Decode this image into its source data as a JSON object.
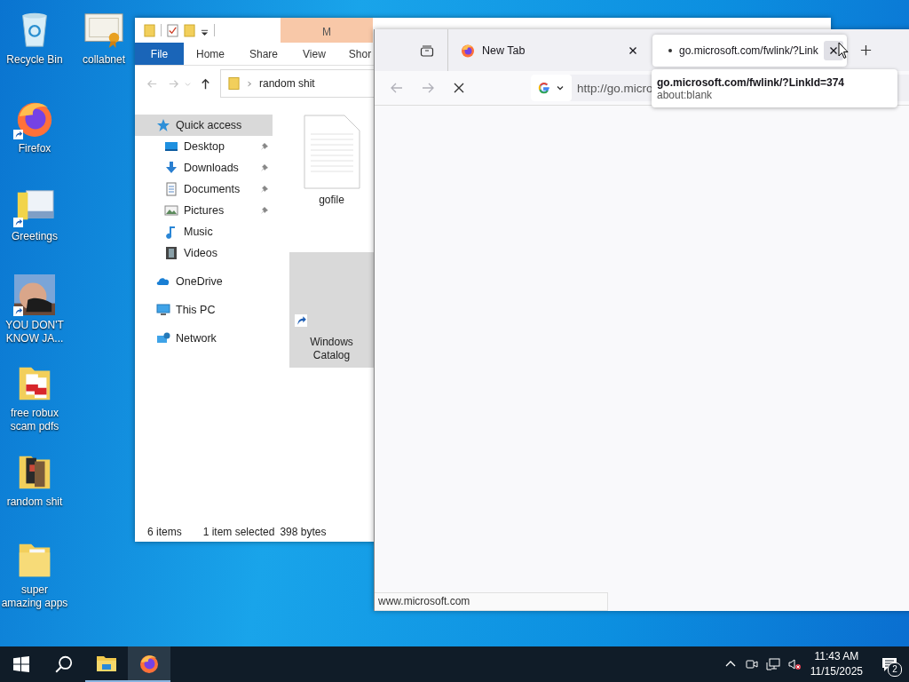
{
  "desktop_icons": [
    {
      "label": "Recycle Bin",
      "kind": "recycle-bin",
      "shortcut": false
    },
    {
      "label": "collabnet",
      "kind": "certificate",
      "shortcut": false
    },
    {
      "label": "Firefox",
      "kind": "firefox",
      "shortcut": true
    },
    {
      "label": "Greetings",
      "kind": "app",
      "shortcut": true
    },
    {
      "label": "YOU DON'T KNOW JA...",
      "kind": "picture",
      "shortcut": true
    },
    {
      "label": "free robux scam pdfs",
      "kind": "pdf-folder",
      "shortcut": false
    },
    {
      "label": "random shit",
      "kind": "film-folder",
      "shortcut": false
    },
    {
      "label": "super amazing apps",
      "kind": "folder",
      "shortcut": false
    }
  ],
  "explorer": {
    "contextual_tab": "M",
    "ribbon_tabs": [
      {
        "label": "File",
        "kind": "file"
      },
      {
        "label": "Home",
        "kind": "tab"
      },
      {
        "label": "Share",
        "kind": "tab"
      },
      {
        "label": "View",
        "kind": "tab"
      },
      {
        "label": "Shor",
        "kind": "tab"
      }
    ],
    "address": "random shit",
    "nav": [
      {
        "label": "Quick access",
        "kind": "star",
        "selected": true,
        "children": [
          {
            "label": "Desktop",
            "kind": "desktop",
            "pinned": true
          },
          {
            "label": "Downloads",
            "kind": "download",
            "pinned": true
          },
          {
            "label": "Documents",
            "kind": "document",
            "pinned": true
          },
          {
            "label": "Pictures",
            "kind": "pictures",
            "pinned": true
          },
          {
            "label": "Music",
            "kind": "music",
            "pinned": false
          },
          {
            "label": "Videos",
            "kind": "videos",
            "pinned": false
          }
        ]
      },
      {
        "label": "OneDrive",
        "kind": "cloud",
        "selected": false
      },
      {
        "label": "This PC",
        "kind": "pc",
        "selected": false
      },
      {
        "label": "Network",
        "kind": "network",
        "selected": false
      }
    ],
    "files": [
      {
        "name": "gofile",
        "kind": "text-file",
        "selected": false
      },
      {
        "name": "Windows Catalog",
        "kind": "shortcut",
        "selected": true
      }
    ],
    "status": [
      "6 items",
      "1 item selected",
      "398 bytes"
    ]
  },
  "browser": {
    "tabs": [
      {
        "title": "New Tab",
        "selected": false,
        "loading": false
      },
      {
        "title": "go.microsoft.com/fwlink/?Link",
        "selected": true,
        "loading": true
      }
    ],
    "url": "http://go.micro",
    "tooltip": {
      "title": "go.microsoft.com/fwlink/?LinkId=374",
      "subtitle": "about:blank"
    },
    "status": "www.microsoft.com"
  },
  "taskbar": {
    "apps": [
      {
        "kind": "explorer",
        "active": false
      },
      {
        "kind": "firefox",
        "active": true
      }
    ],
    "time": "11:43 AM",
    "date": "11/15/2025",
    "notifications": "2"
  }
}
